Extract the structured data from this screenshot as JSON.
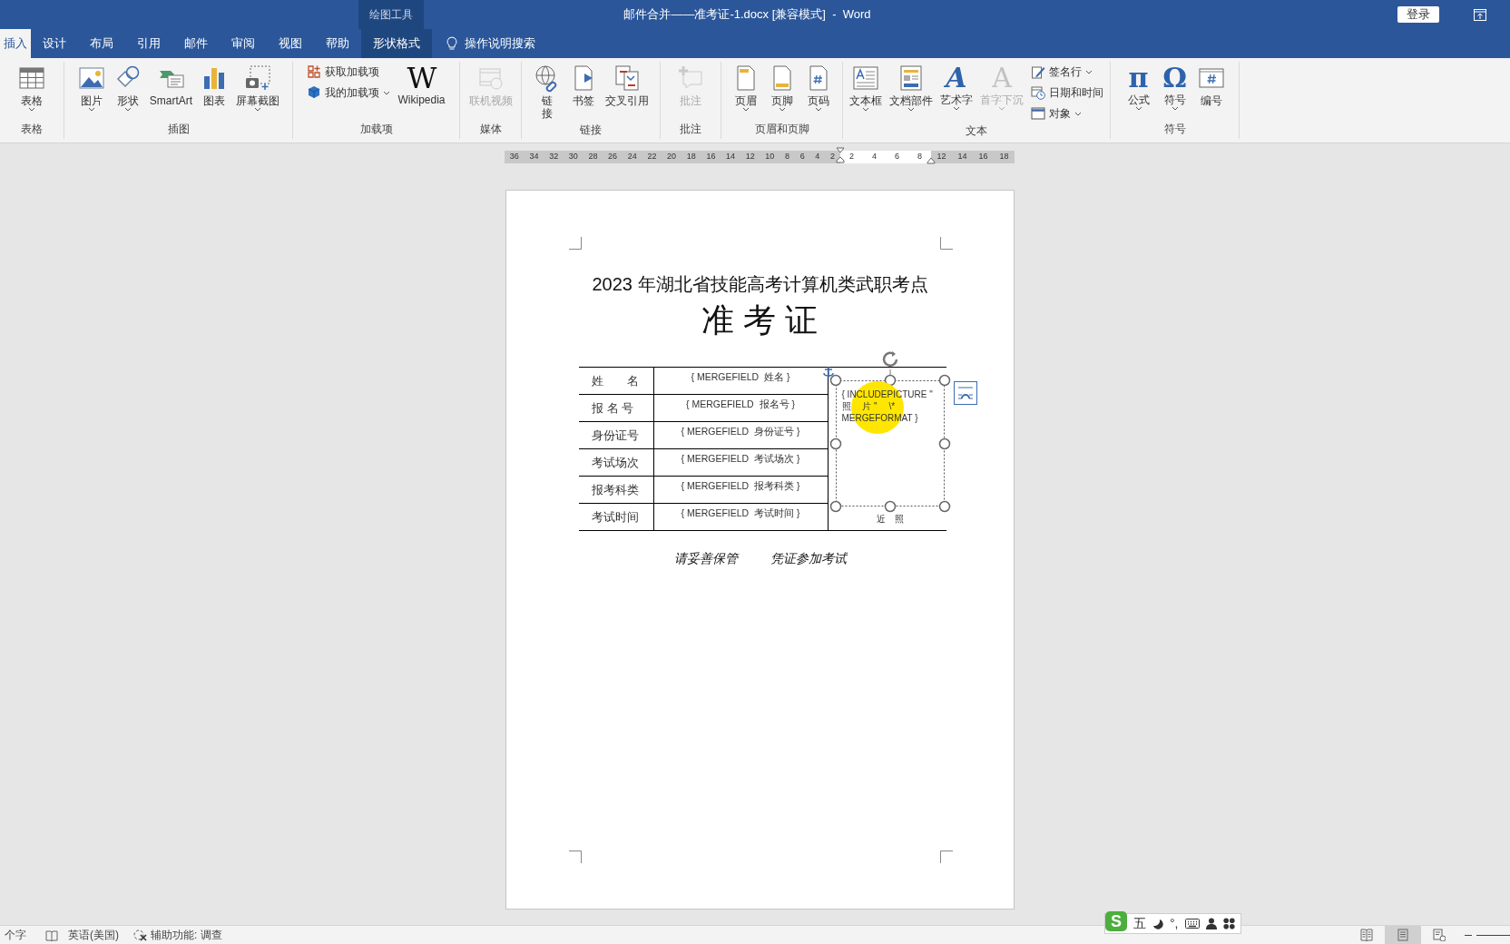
{
  "window": {
    "contextual_group": "绘图工具",
    "title": "邮件合并——准考证-1.docx [兼容模式]  -  Word",
    "sign_in": "登录"
  },
  "tabs": [
    {
      "label": "插入",
      "selected": true,
      "contextual": false
    },
    {
      "label": "设计",
      "selected": false,
      "contextual": false
    },
    {
      "label": "布局",
      "selected": false,
      "contextual": false
    },
    {
      "label": "引用",
      "selected": false,
      "contextual": false
    },
    {
      "label": "邮件",
      "selected": false,
      "contextual": false
    },
    {
      "label": "审阅",
      "selected": false,
      "contextual": false
    },
    {
      "label": "视图",
      "selected": false,
      "contextual": false
    },
    {
      "label": "帮助",
      "selected": false,
      "contextual": false
    },
    {
      "label": "形状格式",
      "selected": false,
      "contextual": true
    }
  ],
  "tell_me": "操作说明搜索",
  "ribbon_groups": [
    {
      "label": "表格",
      "items": [
        {
          "label": "表格",
          "kind": "large",
          "dropdown": true,
          "disabled": false
        }
      ]
    },
    {
      "label": "插图",
      "items": [
        {
          "label": "图片",
          "kind": "large",
          "dropdown": true,
          "disabled": false
        },
        {
          "label": "形状",
          "kind": "large",
          "dropdown": true,
          "disabled": false
        },
        {
          "label": "SmartArt",
          "kind": "large",
          "dropdown": false,
          "disabled": false
        },
        {
          "label": "图表",
          "kind": "large",
          "dropdown": false,
          "disabled": false
        },
        {
          "label": "屏幕截图",
          "kind": "large",
          "dropdown": true,
          "disabled": false
        }
      ]
    },
    {
      "label": "加载项",
      "items": [
        {
          "label": "获取加载项",
          "kind": "small",
          "dropdown": false,
          "disabled": false
        },
        {
          "label": "我的加载项",
          "kind": "small",
          "dropdown": true,
          "disabled": false
        },
        {
          "label": "Wikipedia",
          "kind": "large",
          "glyph": "W",
          "dropdown": false,
          "disabled": false
        }
      ]
    },
    {
      "label": "媒体",
      "items": [
        {
          "label": "联机视频",
          "kind": "large",
          "dropdown": false,
          "disabled": true
        }
      ]
    },
    {
      "label": "链接",
      "items": [
        {
          "label": "链接",
          "kind": "large",
          "dropdown": false,
          "disabled": false
        },
        {
          "label": "书签",
          "kind": "large",
          "dropdown": false,
          "disabled": false
        },
        {
          "label": "交叉引用",
          "kind": "large",
          "dropdown": false,
          "disabled": false
        }
      ]
    },
    {
      "label": "批注",
      "items": [
        {
          "label": "批注",
          "kind": "large",
          "dropdown": false,
          "disabled": true
        }
      ]
    },
    {
      "label": "页眉和页脚",
      "items": [
        {
          "label": "页眉",
          "kind": "large",
          "dropdown": true,
          "disabled": false
        },
        {
          "label": "页脚",
          "kind": "large",
          "dropdown": true,
          "disabled": false
        },
        {
          "label": "页码",
          "kind": "large",
          "dropdown": true,
          "disabled": false
        }
      ]
    },
    {
      "label": "文本",
      "items": [
        {
          "label": "文本框",
          "kind": "large",
          "dropdown": true,
          "disabled": false
        },
        {
          "label": "文档部件",
          "kind": "large",
          "dropdown": true,
          "disabled": false
        },
        {
          "label": "艺术字",
          "kind": "large",
          "glyph": "A",
          "dropdown": true,
          "disabled": false
        },
        {
          "label": "首字下沉",
          "kind": "large",
          "glyph": "A",
          "dropdown": true,
          "disabled": true
        },
        {
          "label": "签名行",
          "kind": "small",
          "dropdown": true,
          "disabled": false
        },
        {
          "label": "日期和时间",
          "kind": "small",
          "dropdown": false,
          "disabled": false
        },
        {
          "label": "对象",
          "kind": "small",
          "dropdown": true,
          "disabled": false
        }
      ]
    },
    {
      "label": "符号",
      "items": [
        {
          "label": "公式",
          "kind": "large",
          "glyph": "π",
          "dropdown": true,
          "disabled": false
        },
        {
          "label": "符号",
          "kind": "large",
          "glyph": "Ω",
          "dropdown": true,
          "disabled": false
        },
        {
          "label": "编号",
          "kind": "large",
          "dropdown": false,
          "disabled": false
        }
      ]
    }
  ],
  "ruler": [
    {
      "label": "36",
      "margin": true
    },
    {
      "label": "34",
      "margin": true
    },
    {
      "label": "32",
      "margin": true
    },
    {
      "label": "30",
      "margin": true
    },
    {
      "label": "28",
      "margin": true
    },
    {
      "label": "26",
      "margin": true
    },
    {
      "label": "24",
      "margin": true
    },
    {
      "label": "22",
      "margin": true
    },
    {
      "label": "20",
      "margin": true
    },
    {
      "label": "18",
      "margin": true
    },
    {
      "label": "16",
      "margin": true
    },
    {
      "label": "14",
      "margin": true
    },
    {
      "label": "12",
      "margin": true
    },
    {
      "label": "10",
      "margin": true
    },
    {
      "label": "8",
      "margin": true
    },
    {
      "label": "6",
      "margin": true
    },
    {
      "label": "4",
      "margin": true
    },
    {
      "label": "2",
      "margin": true
    },
    {
      "label": "2",
      "margin": false
    },
    {
      "label": "4",
      "margin": false
    },
    {
      "label": "6",
      "margin": false
    },
    {
      "label": "8",
      "margin": false
    },
    {
      "label": "12",
      "margin": true
    },
    {
      "label": "14",
      "margin": true
    },
    {
      "label": "16",
      "margin": true
    },
    {
      "label": "18",
      "margin": true
    }
  ],
  "document": {
    "heading": "2023 年湖北省技能高考计算机类武职考点",
    "title": "准 考 证",
    "rows": [
      {
        "label": "姓　　名",
        "field": "{ MERGEFIELD  姓名 }"
      },
      {
        "label": "报 名 号",
        "field": "{ MERGEFIELD  报名号 }"
      },
      {
        "label": "身份证号",
        "field": "{ MERGEFIELD  身份证号 }"
      },
      {
        "label": "考试场次",
        "field": "{ MERGEFIELD  考试场次 }"
      },
      {
        "label": "报考科类",
        "field": "{ MERGEFIELD  报考科类 }"
      },
      {
        "label": "考试时间",
        "field": "{ MERGEFIELD  考试时间 }"
      }
    ],
    "photo_field": [
      "{ INCLUDEPICTURE \"",
      "照　 片 \"　 \\*",
      "MERGEFORMAT }"
    ],
    "photo_caption": "近　照",
    "footer": [
      "请妥善保管",
      "凭证参加考试"
    ]
  },
  "status_bar": {
    "word_count": "个字",
    "language": "英语(美国)",
    "accessibility": "辅助功能: 调查",
    "views": [
      {
        "selected": false
      },
      {
        "selected": true
      },
      {
        "selected": false
      }
    ]
  },
  "ime": {
    "logo": "S",
    "mode": "五",
    "punctuation": "°,"
  }
}
